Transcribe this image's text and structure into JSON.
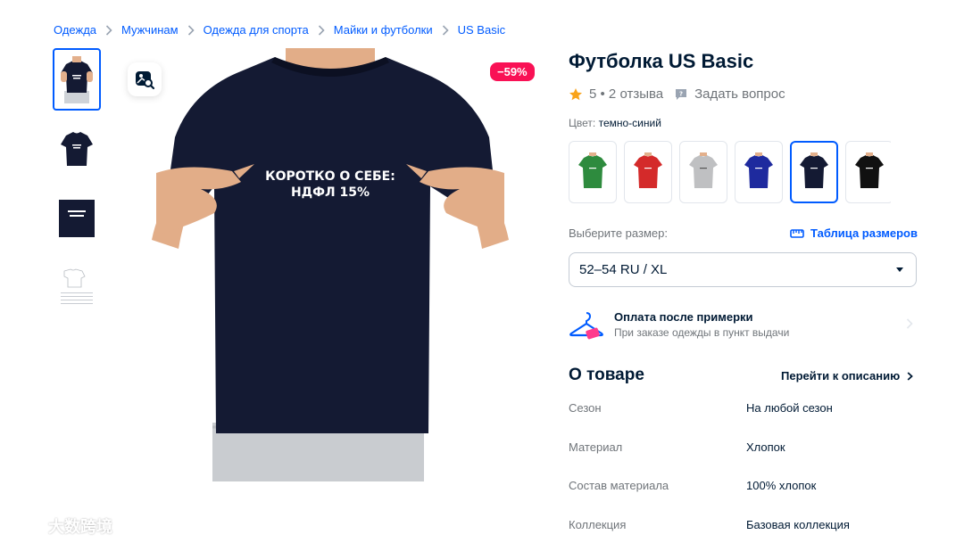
{
  "breadcrumb": [
    {
      "label": "Одежда"
    },
    {
      "label": "Мужчинам"
    },
    {
      "label": "Одежда для спорта"
    },
    {
      "label": "Майки и футболки"
    },
    {
      "label": "US Basic"
    }
  ],
  "product": {
    "title": "Футболка US Basic",
    "discount": "−59%",
    "print_line1": "КОРОТКО О СЕБЕ:",
    "print_line2": "НДФЛ 15%",
    "thumb_text": "КОРОТКО О СЕБЕ: НДФЛ 15%"
  },
  "rating": {
    "text": "5 • 2 отзыва",
    "ask": "Задать вопрос"
  },
  "color": {
    "label": "Цвет:",
    "selected": "темно-синий",
    "swatches": [
      {
        "name": "green",
        "hex": "#2e8b3e"
      },
      {
        "name": "red",
        "hex": "#d42a2a"
      },
      {
        "name": "gray",
        "hex": "#bfc0c2"
      },
      {
        "name": "blue",
        "hex": "#1e2a9e"
      },
      {
        "name": "navy",
        "hex": "#141a33",
        "selected": true
      },
      {
        "name": "black",
        "hex": "#111111"
      }
    ]
  },
  "size": {
    "label": "Выберите размер:",
    "table_link": "Таблица размеров",
    "selected": "52–54 RU / XL"
  },
  "tryon": {
    "title": "Оплата после примерки",
    "subtitle": "При заказе одежды в пункт выдачи"
  },
  "about": {
    "title": "О товаре",
    "link": "Перейти к описанию",
    "specs": [
      {
        "key": "Сезон",
        "value": "На любой сезон"
      },
      {
        "key": "Материал",
        "value": "Хлопок"
      },
      {
        "key": "Состав материала",
        "value": "100% хлопок"
      },
      {
        "key": "Коллекция",
        "value": "Базовая коллекция"
      }
    ]
  },
  "watermark": {
    "text": "大数跨境"
  },
  "colors": {
    "accent": "#005bff",
    "badge": "#f91155",
    "star": "#f9a31a",
    "shirt": "#141a33"
  }
}
